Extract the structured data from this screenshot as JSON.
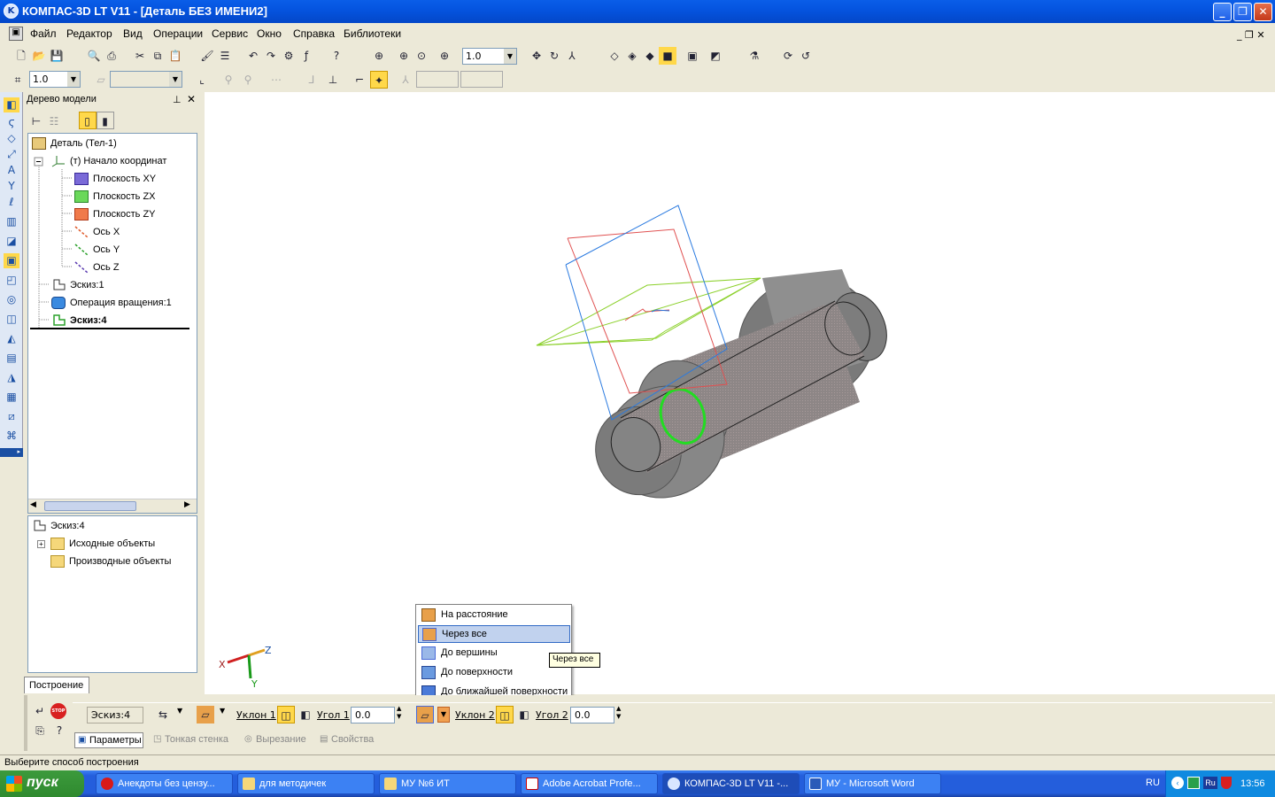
{
  "window": {
    "title": "КОМПАС-3D LT V11 - [Деталь БЕЗ ИМЕНИ2]",
    "icon": "K"
  },
  "menu": [
    "Файл",
    "Редактор",
    "Вид",
    "Операции",
    "Сервис",
    "Окно",
    "Справка",
    "Библиотеки"
  ],
  "toolbar": {
    "zoom_value": "1.0",
    "step_value": "1.0"
  },
  "tree_panel": {
    "title": "Дерево модели",
    "items": [
      {
        "label": "Деталь (Тел-1)",
        "icon": "part-icon"
      },
      {
        "label": "(т) Начало координат",
        "icon": "origin-icon"
      },
      {
        "label": "Плоскость XY",
        "icon": "plane-icon"
      },
      {
        "label": "Плоскость ZX",
        "icon": "plane-icon"
      },
      {
        "label": "Плоскость ZY",
        "icon": "plane-icon"
      },
      {
        "label": "Ось X",
        "icon": "axis-icon"
      },
      {
        "label": "Ось Y",
        "icon": "axis-icon"
      },
      {
        "label": "Ось Z",
        "icon": "axis-icon"
      },
      {
        "label": "Эскиз:1",
        "icon": "sketch-icon"
      },
      {
        "label": "Операция вращения:1",
        "icon": "revolve-icon"
      },
      {
        "label": "Эскиз:4",
        "icon": "sketch-icon"
      }
    ],
    "sub_tree": {
      "title": "Эскиз:4",
      "items": [
        "Исходные объекты",
        "Производные объекты"
      ]
    },
    "tab": "Построение"
  },
  "popup": {
    "items": [
      "На расстояние",
      "Через все",
      "До вершины",
      "До поверхности",
      "До ближайшей поверхности"
    ],
    "selected": "Через все",
    "tooltip": "Через все"
  },
  "axes": {
    "x": "X",
    "y": "Y",
    "z": "Z"
  },
  "propbar": {
    "sketch": "Эскиз:4",
    "slope1": "Уклон 1",
    "angle1_label": "Угол 1",
    "angle1": "0.0",
    "slope2": "Уклон 2",
    "angle2_label": "Угол 2",
    "angle2": "0.0",
    "tabs": [
      "Параметры",
      "Тонкая стенка",
      "Вырезание",
      "Свойства"
    ],
    "stop": "STOP"
  },
  "status": "Выберите способ построения",
  "taskbar": {
    "start": "пуск",
    "tasks": [
      "Анекдоты без цензу...",
      "для методичек",
      "МУ №6 ИТ",
      "Adobe Acrobat Profe...",
      "КОМПАС-3D LT V11 -...",
      "МУ - Microsoft Word"
    ],
    "lang": "RU",
    "lang2": "Ru",
    "clock": "13:56"
  },
  "colors": {
    "title_blue": "#0554e0",
    "selection": "#c1d2ee",
    "part_gray": "#8a8a8a"
  }
}
